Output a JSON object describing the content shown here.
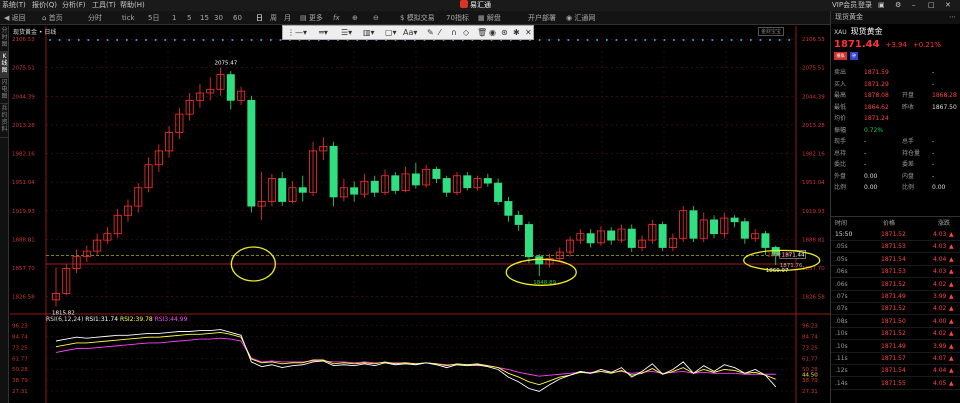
{
  "menu": {
    "items": [
      "系统(T)",
      "报价(Q)",
      "分析(F)",
      "工具(T)",
      "帮助(H)"
    ],
    "right": [
      "VIP会员",
      "登录"
    ]
  },
  "title": "易汇通",
  "toolbar": {
    "items": [
      "返回",
      "首页",
      "分时",
      "tick",
      "5日",
      "1",
      "5",
      "15",
      "30",
      "60",
      "日",
      "周",
      "月",
      "更多",
      "fx",
      "⊕",
      "⊖",
      "模拟交易",
      "70指标",
      "解盘",
      "开户部署",
      "汇通网"
    ]
  },
  "sidetabs": [
    "分时图",
    "K线图",
    "闪电图",
    "兵约资料"
  ],
  "chart": {
    "symbol_label": "现货黄金 • 日线",
    "quality_box": "金财宝宝",
    "price_axis": [
      "2106.53",
      "2075.51",
      "2044.39",
      "2013.28",
      "1982.16",
      "1951.04",
      "1919.93",
      "1888.81",
      "1857.70",
      "1826.58"
    ],
    "rsi_axis": [
      "96.23",
      "84.74",
      "73.25",
      "61.77",
      "50.28",
      "38.79",
      "27.31"
    ],
    "rsi_axis_right_extra": "44.50",
    "annotations": {
      "high": "2075.47",
      "low1": "1815.82",
      "low2": "1848.89",
      "low3": "1860.97",
      "last_box": "1871.44",
      "ref_red": "1862.03",
      "ref_below": "1871.76"
    },
    "rsi_legend": {
      "title": "RSI(6,12,24)",
      "rsi1": "RSI1:31.74",
      "rsi2": "RSI2:39.78",
      "rsi3": "RSI3:44.99"
    },
    "colors": {
      "up": "#ff3030",
      "down": "#30e080",
      "rsi1": "#ffffff",
      "rsi2": "#ffff40",
      "rsi3": "#ff40ff",
      "grid": "#551111"
    }
  },
  "chart_data": {
    "type": "candlestick",
    "ylim": [
      1812,
      2110
    ],
    "candles": [
      [
        1823,
        1830,
        1815.82,
        1858
      ],
      [
        1830,
        1857,
        1828,
        1862
      ],
      [
        1857,
        1870,
        1852,
        1878
      ],
      [
        1870,
        1876,
        1864,
        1882
      ],
      [
        1876,
        1888,
        1872,
        1895
      ],
      [
        1888,
        1895,
        1884,
        1902
      ],
      [
        1895,
        1915,
        1890,
        1922
      ],
      [
        1915,
        1925,
        1908,
        1932
      ],
      [
        1925,
        1945,
        1918,
        1950
      ],
      [
        1945,
        1970,
        1940,
        1978
      ],
      [
        1970,
        1985,
        1962,
        1992
      ],
      [
        1985,
        2005,
        1978,
        2012
      ],
      [
        2005,
        2025,
        1998,
        2032
      ],
      [
        2025,
        2040,
        2018,
        2048
      ],
      [
        2040,
        2048,
        2032,
        2058
      ],
      [
        2048,
        2052,
        2040,
        2065
      ],
      [
        2052,
        2068,
        2045,
        2075.47
      ],
      [
        2068,
        2040,
        2030,
        2072
      ],
      [
        2040,
        2050,
        2035,
        2055
      ],
      [
        2040,
        1925,
        1918,
        2045
      ],
      [
        1925,
        1930,
        1910,
        1962
      ],
      [
        1930,
        1955,
        1925,
        1960
      ],
      [
        1955,
        1930,
        1925,
        1962
      ],
      [
        1930,
        1945,
        1928,
        1952
      ],
      [
        1945,
        1940,
        1930,
        1958
      ],
      [
        1940,
        1985,
        1936,
        1995
      ],
      [
        1985,
        1990,
        1975,
        2000
      ],
      [
        1990,
        1935,
        1925,
        1995
      ],
      [
        1935,
        1945,
        1930,
        1955
      ],
      [
        1945,
        1938,
        1930,
        1952
      ],
      [
        1938,
        1952,
        1934,
        1960
      ],
      [
        1952,
        1940,
        1935,
        1958
      ],
      [
        1940,
        1958,
        1937,
        1965
      ],
      [
        1958,
        1942,
        1938,
        1962
      ],
      [
        1942,
        1960,
        1940,
        1968
      ],
      [
        1960,
        1948,
        1944,
        1972
      ],
      [
        1948,
        1965,
        1945,
        1970
      ],
      [
        1965,
        1955,
        1950,
        1968
      ],
      [
        1955,
        1940,
        1935,
        1958
      ],
      [
        1940,
        1958,
        1937,
        1962
      ],
      [
        1958,
        1945,
        1942,
        1962
      ],
      [
        1945,
        1955,
        1942,
        1958
      ],
      [
        1955,
        1950,
        1946,
        1960
      ],
      [
        1950,
        1930,
        1926,
        1955
      ],
      [
        1930,
        1915,
        1908,
        1935
      ],
      [
        1915,
        1905,
        1898,
        1920
      ],
      [
        1905,
        1870,
        1863,
        1908
      ],
      [
        1870,
        1862,
        1848.89,
        1873
      ],
      [
        1862,
        1868,
        1858,
        1873
      ],
      [
        1868,
        1875,
        1864,
        1880
      ],
      [
        1875,
        1888,
        1870,
        1892
      ],
      [
        1888,
        1895,
        1884,
        1900
      ],
      [
        1895,
        1885,
        1880,
        1900
      ],
      [
        1885,
        1898,
        1882,
        1903
      ],
      [
        1898,
        1888,
        1883,
        1902
      ],
      [
        1888,
        1900,
        1885,
        1905
      ],
      [
        1900,
        1880,
        1875,
        1905
      ],
      [
        1880,
        1888,
        1876,
        1893
      ],
      [
        1888,
        1905,
        1884,
        1910
      ],
      [
        1905,
        1880,
        1876,
        1908
      ],
      [
        1880,
        1890,
        1876,
        1895
      ],
      [
        1890,
        1920,
        1886,
        1925
      ],
      [
        1920,
        1890,
        1886,
        1925
      ],
      [
        1890,
        1910,
        1886,
        1918
      ],
      [
        1910,
        1895,
        1890,
        1915
      ],
      [
        1895,
        1912,
        1890,
        1918
      ],
      [
        1912,
        1908,
        1902,
        1915
      ],
      [
        1908,
        1890,
        1884,
        1912
      ],
      [
        1890,
        1895,
        1886,
        1900
      ],
      [
        1895,
        1880,
        1872,
        1898
      ],
      [
        1880,
        1871.44,
        1860.97,
        1882
      ]
    ],
    "rsi": {
      "rsi1": [
        80,
        82,
        84,
        83,
        84,
        85,
        86,
        86,
        87,
        88,
        88,
        89,
        90,
        90,
        91,
        91,
        92,
        89,
        86,
        58,
        53,
        55,
        52,
        54,
        55,
        58,
        59,
        54,
        55,
        54,
        56,
        54,
        57,
        55,
        56,
        55,
        57,
        55,
        52,
        55,
        54,
        55,
        53,
        50,
        42,
        37,
        30,
        27,
        34,
        40,
        44,
        48,
        46,
        50,
        47,
        52,
        42,
        48,
        56,
        45,
        50,
        58,
        46,
        54,
        48,
        55,
        52,
        46,
        50,
        44,
        31.74
      ],
      "rsi2": [
        74,
        76,
        78,
        78,
        79,
        80,
        81,
        82,
        83,
        84,
        84,
        85,
        86,
        87,
        87,
        88,
        89,
        87,
        84,
        61,
        57,
        58,
        56,
        57,
        57,
        60,
        60,
        56,
        57,
        56,
        57,
        56,
        58,
        56,
        57,
        56,
        57,
        56,
        54,
        56,
        55,
        56,
        54,
        52,
        46,
        42,
        37,
        34,
        38,
        42,
        44,
        47,
        46,
        48,
        46,
        49,
        44,
        46,
        51,
        45,
        48,
        52,
        46,
        50,
        47,
        50,
        49,
        46,
        47,
        44,
        39.78
      ],
      "rsi3": [
        68,
        70,
        72,
        72,
        73,
        74,
        75,
        76,
        77,
        78,
        78,
        79,
        80,
        81,
        82,
        82,
        83,
        82,
        80,
        62,
        58,
        59,
        58,
        58,
        58,
        59,
        59,
        58,
        58,
        57,
        58,
        57,
        57,
        57,
        57,
        56,
        57,
        56,
        55,
        55,
        55,
        54,
        54,
        52,
        50,
        47,
        45,
        43,
        44,
        45,
        46,
        47,
        47,
        48,
        47,
        48,
        46,
        47,
        48,
        46,
        47,
        48,
        46,
        47,
        46,
        46,
        46,
        45,
        45,
        45,
        44.99
      ]
    }
  },
  "quote": {
    "header": {
      "label": "现货黄金",
      "more": "⋯"
    },
    "code": "XAU",
    "name": "现货黄金",
    "price": "1871.44",
    "change": "+3.94",
    "pct": "+0.21%",
    "badges": [
      "模拟",
      "钟"
    ],
    "rows": [
      {
        "l": "卖出",
        "v": "1871.59",
        "l2": "",
        "v2": "-"
      },
      {
        "l": "买入",
        "v": "1871.29",
        "l2": "",
        "v2": "-"
      },
      {
        "l": "最高",
        "v": "1878.08",
        "l2": "开盘",
        "v2": "1868.28"
      },
      {
        "l": "最低",
        "v": "1864.62",
        "l2": "昨收",
        "v2": "1867.50"
      },
      {
        "l": "均价",
        "v": "1871.24",
        "l2": "",
        "v2": ""
      },
      {
        "l": "振幅",
        "v": "0.72%",
        "l2": "",
        "v2": ""
      },
      {
        "l": "现手",
        "v": "-",
        "l2": "总手",
        "v2": "-"
      },
      {
        "l": "总持",
        "v": "-",
        "l2": "持仓量",
        "v2": "-"
      },
      {
        "l": "委比",
        "v": "-",
        "l2": "委差",
        "v2": "-"
      },
      {
        "l": "外盘",
        "v": "0.00",
        "l2": "内盘",
        "v2": "-"
      },
      {
        "l": "比例",
        "v": "0.00",
        "l2": "比例",
        "v2": "0.00"
      }
    ],
    "tick_header": [
      "时间",
      "价格",
      "涨跌"
    ],
    "ticks": [
      {
        "t": "15:50",
        "p": "1871.52",
        "c": "4.03"
      },
      {
        "t": ".05s",
        "p": "1871.53",
        "c": "4.03"
      },
      {
        "t": ".05s",
        "p": "1871.54",
        "c": "4.04"
      },
      {
        "t": ".06s",
        "p": "1871.53",
        "c": "4.03"
      },
      {
        "t": ".06s",
        "p": "1871.52",
        "c": "4.02"
      },
      {
        "t": ".07s",
        "p": "1871.49",
        "c": "3.99"
      },
      {
        "t": ".07s",
        "p": "1871.52",
        "c": "4.02"
      },
      {
        "t": ".08s",
        "p": "1871.50",
        "c": "4.00"
      },
      {
        "t": ".10s",
        "p": "1871.52",
        "c": "4.02"
      },
      {
        "t": ".10s",
        "p": "1871.49",
        "c": "3.99"
      },
      {
        "t": ".11s",
        "p": "1871.57",
        "c": "4.07"
      },
      {
        "t": ".12s",
        "p": "1871.54",
        "c": "4.04"
      },
      {
        "t": ".14s",
        "p": "1871.55",
        "c": "4.05"
      }
    ]
  }
}
